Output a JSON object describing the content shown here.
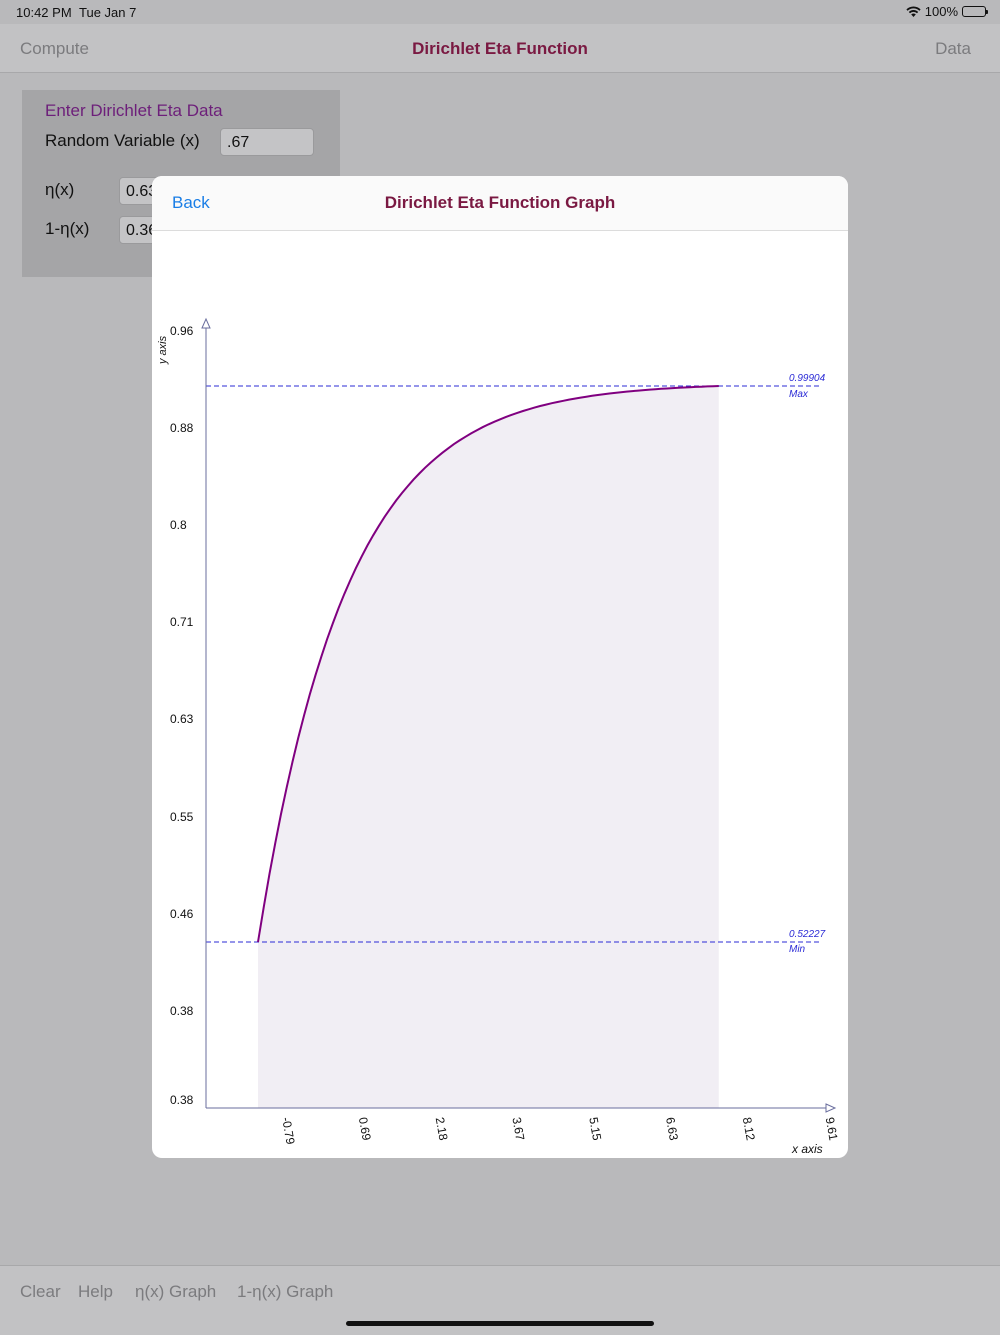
{
  "status": {
    "time": "10:42 PM",
    "date": "Tue Jan 7",
    "battery": "100%"
  },
  "nav": {
    "left": "Compute",
    "title": "Dirichlet Eta Function",
    "right": "Data"
  },
  "panel": {
    "heading": "Enter Dirichlet Eta Data",
    "random_label": "Random Variable (x)",
    "random_value": ".67",
    "eta_label": "η(x)",
    "eta_value": "0.63",
    "comp_label": "1-η(x)",
    "comp_value": "0.36"
  },
  "modal": {
    "back": "Back",
    "title": "Dirichlet Eta Function Graph"
  },
  "chart_data": {
    "type": "area",
    "xlabel": "x axis",
    "ylabel": "y axis",
    "x_ticks": [
      "-0.79",
      "0.69",
      "2.18",
      "3.67",
      "5.15",
      "6.63",
      "8.12",
      "9.61"
    ],
    "y_ticks": [
      "0.38",
      "0.38",
      "0.46",
      "0.55",
      "0.63",
      "0.71",
      "0.8",
      "0.88",
      "0.96"
    ],
    "max_value": "0.99904",
    "max_label": "Max",
    "min_value": "0.52227",
    "min_label": "Min",
    "curve": {
      "x_start": -0.79,
      "x_end": 8.12,
      "y_start": 0.52227,
      "y_end": 0.99904
    },
    "colors": {
      "line": "#800080",
      "fill": "#f1eef4",
      "axis": "#6a6e9e",
      "guides": "#2b2bd6"
    }
  },
  "toolbar": {
    "clear": "Clear",
    "help": "Help",
    "eta_graph": "η(x) Graph",
    "comp_graph": "1-η(x) Graph"
  }
}
